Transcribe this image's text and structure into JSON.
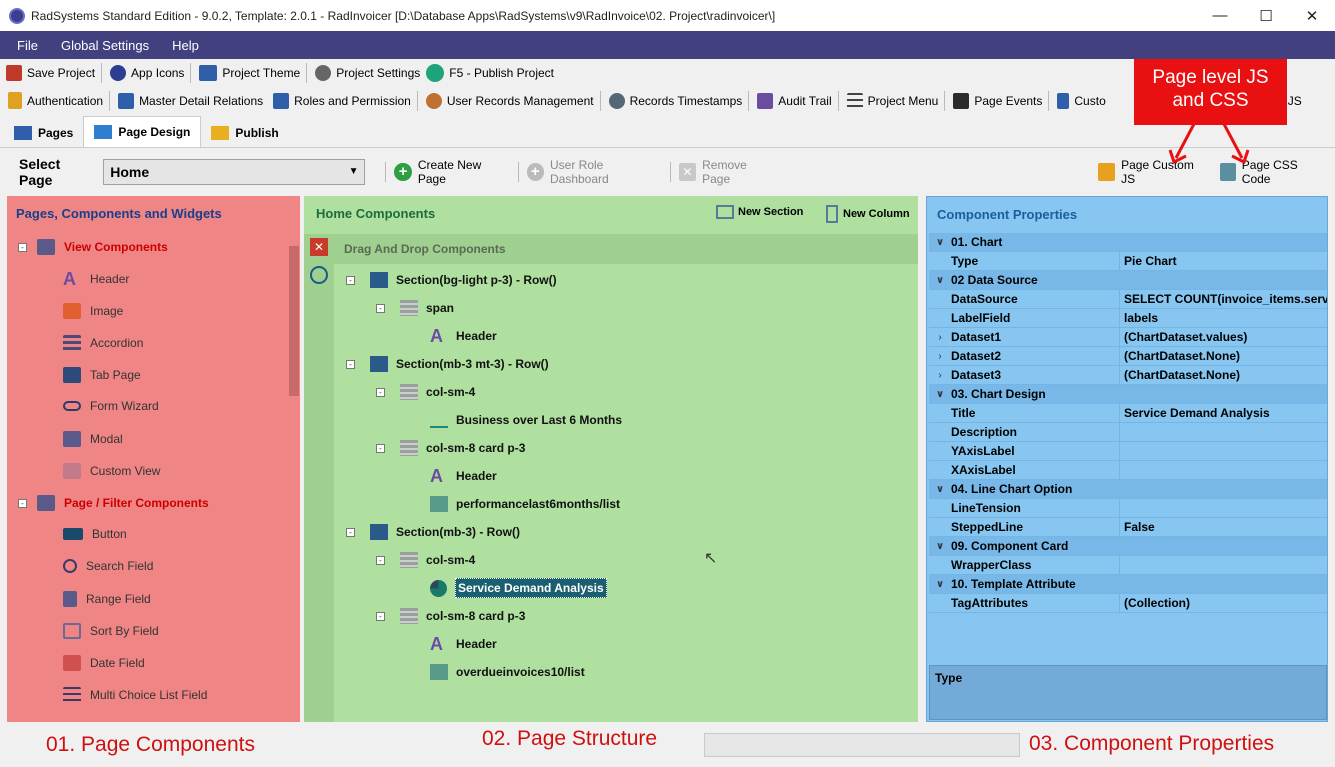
{
  "window": {
    "title": "RadSystems Standard Edition - 9.0.2, Template: 2.0.1 - RadInvoicer [D:\\Database Apps\\RadSystems\\v9\\RadInvoice\\02. Project\\radinvoicer\\]"
  },
  "menu": [
    "File",
    "Global Settings",
    "Help"
  ],
  "toolbar1": [
    {
      "label": "Save Project",
      "icon": "save-icon",
      "color": "#c0392b"
    },
    {
      "label": "App Icons",
      "icon": "app-icons-icon",
      "color": "#2c3e8f"
    },
    {
      "label": "Project Theme",
      "icon": "theme-icon",
      "color": "#2e5fa8"
    },
    {
      "label": "Project Settings",
      "icon": "gear-icon",
      "color": "#666666"
    },
    {
      "label": "F5 - Publish Project",
      "icon": "play-icon",
      "color": "#1fa37a"
    }
  ],
  "toolbar2": [
    {
      "label": "Authentication",
      "icon": "lock-icon",
      "color": "#e0a020"
    },
    {
      "label": "Master Detail Relations",
      "icon": "table-icon",
      "color": "#2e5fa8"
    },
    {
      "label": "Roles and Permission",
      "icon": "roles-icon",
      "color": "#2e5fa8"
    },
    {
      "label": "User Records Management",
      "icon": "user-icon",
      "color": "#c07030"
    },
    {
      "label": "Records Timestamps",
      "icon": "gear-icon",
      "color": "#556677"
    },
    {
      "label": "Audit Trail",
      "icon": "audit-icon",
      "color": "#6a4ca0"
    },
    {
      "label": "Project Menu",
      "icon": "menu-icon",
      "color": "#444444"
    },
    {
      "label": "Page Events",
      "icon": "events-icon",
      "color": "#2c2c2c"
    },
    {
      "label": "Custo",
      "icon": "custom-icon",
      "color": "#2e5fa8"
    },
    {
      "label": "JS",
      "icon": "",
      "color": ""
    }
  ],
  "tabs": [
    {
      "label": "Pages",
      "icon": "pages-icon"
    },
    {
      "label": "Page Design",
      "icon": "page-design-icon"
    },
    {
      "label": "Publish",
      "icon": "publish-icon"
    }
  ],
  "select_page": {
    "label": "Select Page",
    "value": "Home"
  },
  "actions": {
    "create": "Create New Page",
    "dashboard": "User Role Dashboard",
    "remove": "Remove Page",
    "custom_js": "Page Custom JS",
    "css_code": "Page CSS Code"
  },
  "left_panel": {
    "title": "Pages, Components and Widgets",
    "group1": "View Components",
    "group1_items": [
      "Header",
      "Image",
      "Accordion",
      "Tab Page",
      "Form Wizard",
      "Modal",
      "Custom View"
    ],
    "group2": "Page / Filter Components",
    "group2_items": [
      "Button",
      "Search Field",
      "Range Field",
      "Sort By Field",
      "Date Field",
      "Multi Choice List Field"
    ]
  },
  "mid_panel": {
    "title": "Home Components",
    "new_section": "New Section",
    "new_column": "New Column",
    "drag_hint": "Drag And Drop Components",
    "nodes": [
      "Section(bg-light p-3) - Row()",
      "span",
      "Header",
      "Section(mb-3 mt-3) - Row()",
      "col-sm-4",
      "Business over Last 6 Months",
      "col-sm-8 card p-3",
      "Header",
      "performancelast6months/list",
      "Section(mb-3) - Row()",
      "col-sm-4",
      "Service Demand Analysis",
      "col-sm-8 card p-3",
      "Header",
      "overdueinvoices10/list"
    ]
  },
  "right_panel": {
    "title": "Component Properties",
    "rows": [
      {
        "cat": true,
        "key": "01. Chart",
        "val": ""
      },
      {
        "cat": false,
        "key": "Type",
        "val": "Pie Chart"
      },
      {
        "cat": true,
        "key": "02 Data Source",
        "val": ""
      },
      {
        "cat": false,
        "key": "DataSource",
        "val": "SELECT    COUNT(invoice_items.servic"
      },
      {
        "cat": false,
        "key": "LabelField",
        "val": "labels"
      },
      {
        "cat": false,
        "key": "Dataset1",
        "val": "(ChartDataset.values)"
      },
      {
        "cat": false,
        "key": "Dataset2",
        "val": "(ChartDataset.None)"
      },
      {
        "cat": false,
        "key": "Dataset3",
        "val": "(ChartDataset.None)"
      },
      {
        "cat": true,
        "key": "03. Chart Design",
        "val": ""
      },
      {
        "cat": false,
        "key": "Title",
        "val": "Service Demand Analysis"
      },
      {
        "cat": false,
        "key": "Description",
        "val": ""
      },
      {
        "cat": false,
        "key": "YAxisLabel",
        "val": ""
      },
      {
        "cat": false,
        "key": "XAxisLabel",
        "val": ""
      },
      {
        "cat": true,
        "key": "04. Line Chart Option",
        "val": ""
      },
      {
        "cat": false,
        "key": "LineTension",
        "val": ""
      },
      {
        "cat": false,
        "key": "SteppedLine",
        "val": "False"
      },
      {
        "cat": true,
        "key": "09. Component Card",
        "val": ""
      },
      {
        "cat": false,
        "key": "WrapperClass",
        "val": ""
      },
      {
        "cat": true,
        "key": "10. Template Attribute",
        "val": ""
      },
      {
        "cat": false,
        "key": "TagAttributes",
        "val": "(Collection)"
      }
    ],
    "description_label": "Type"
  },
  "captions": {
    "c1": "01. Page Components",
    "c2": "02. Page Structure",
    "c3": "03. Component Properties"
  },
  "callout": {
    "line1": "Page level JS",
    "line2": "and CSS"
  }
}
